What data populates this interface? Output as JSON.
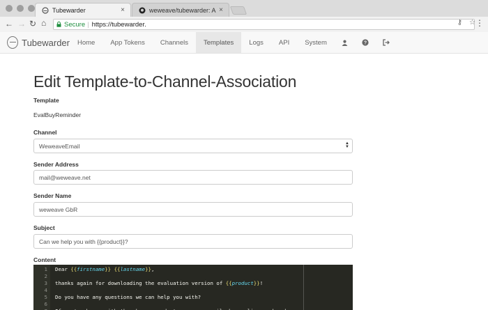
{
  "browser": {
    "tabs": [
      {
        "title": "Tubewarder",
        "close": "×"
      },
      {
        "title": "weweave/tubewarder: A centr",
        "close": "×"
      }
    ],
    "url_secure": "Secure",
    "url_sep": "|",
    "url": "https://tubewarder."
  },
  "nav": {
    "brand": "Tubewarder",
    "items": [
      "Home",
      "App Tokens",
      "Channels",
      "Templates",
      "Logs",
      "API",
      "System"
    ],
    "active_index": 3
  },
  "page": {
    "title": "Edit Template-to-Channel-Association",
    "template_label": "Template",
    "template_value": "EvalBuyReminder",
    "channel_label": "Channel",
    "channel_value": "WeweaveEmail",
    "sender_address_label": "Sender Address",
    "sender_address_value": "mail@weweave.net",
    "sender_name_label": "Sender Name",
    "sender_name_value": "weweave GbR",
    "subject_label": "Subject",
    "subject_value": "Can we help you with {{product}}?",
    "content_label": "Content"
  },
  "editor": {
    "lines": [
      {
        "n": "1",
        "parts": [
          {
            "t": "Dear "
          },
          {
            "t": "{{",
            "c": "brace"
          },
          {
            "t": "firstname",
            "c": "var"
          },
          {
            "t": "}}",
            "c": "brace"
          },
          {
            "t": " "
          },
          {
            "t": "{{",
            "c": "brace"
          },
          {
            "t": "lastname",
            "c": "var"
          },
          {
            "t": "}}",
            "c": "brace"
          },
          {
            "t": ","
          }
        ]
      },
      {
        "n": "2",
        "parts": []
      },
      {
        "n": "3",
        "parts": [
          {
            "t": "thanks again for downloading the evaluation version of "
          },
          {
            "t": "{{",
            "c": "brace"
          },
          {
            "t": "product",
            "c": "var"
          },
          {
            "t": "}}",
            "c": "brace"
          },
          {
            "t": "!"
          }
        ]
      },
      {
        "n": "4",
        "parts": []
      },
      {
        "n": "5",
        "parts": [
          {
            "t": "Do you have any questions we can help you with?"
          }
        ]
      },
      {
        "n": "6",
        "parts": []
      },
      {
        "n": "7",
        "parts": [
          {
            "t": "If you're happy with the chosen product, you can easily buy a license key here:"
          }
        ]
      }
    ]
  }
}
